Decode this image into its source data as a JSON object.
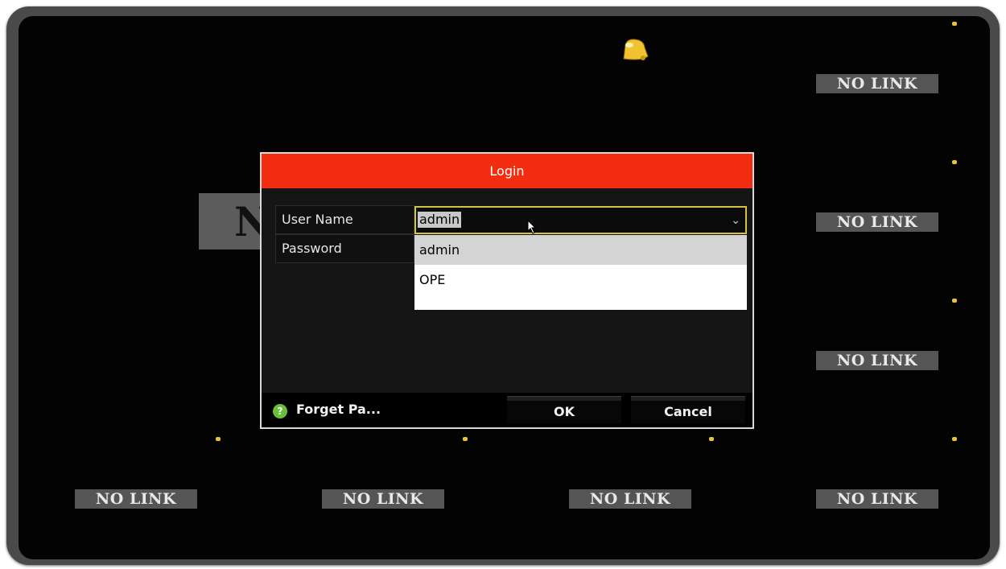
{
  "tiles": {
    "no_link_label": "NO LINK",
    "behind_tile_letter": "N"
  },
  "login_dialog": {
    "title": "Login",
    "username_label": "User Name",
    "username_value": "admin",
    "password_label": "Password",
    "dropdown_options": [
      "admin",
      "OPE"
    ],
    "forget_password_label": "Forget Pa...",
    "ok_label": "OK",
    "cancel_label": "Cancel"
  },
  "colors": {
    "title_bar": "#f32d12",
    "focus_border": "#d6c33d",
    "status_dot": "#e8c23c",
    "help_icon": "#6abf3a"
  },
  "icons": {
    "alarm": "bell-icon",
    "help": "help-icon",
    "dropdown": "chevron-down-icon",
    "pointer": "mouse-cursor-icon"
  }
}
